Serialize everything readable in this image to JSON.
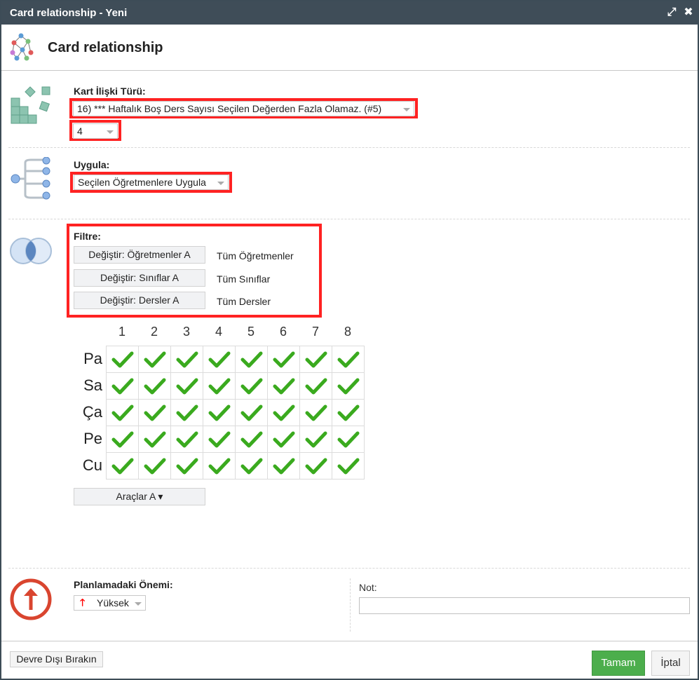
{
  "window": {
    "title": "Card relationship - Yeni",
    "maximize_glyph": "⤢",
    "close_glyph": "✖"
  },
  "header": {
    "title": "Card relationship"
  },
  "card_type": {
    "label": "Kart İlişki Türü:",
    "selected": "16) *** Haftalık Boş Ders Sayısı Seçilen Değerden Fazla Olamaz. (#5)",
    "value_selected": "4"
  },
  "apply": {
    "label": "Uygula:",
    "selected": "Seçilen Öğretmenlere Uygula"
  },
  "filter": {
    "label": "Filtre:",
    "rows": [
      {
        "button": "Değiştir: Öğretmenler A",
        "value": "Tüm Öğretmenler"
      },
      {
        "button": "Değiştir: Sınıflar A",
        "value": "Tüm Sınıflar"
      },
      {
        "button": "Değiştir: Dersler A",
        "value": "Tüm Dersler"
      }
    ]
  },
  "grid": {
    "columns": [
      "1",
      "2",
      "3",
      "4",
      "5",
      "6",
      "7",
      "8"
    ],
    "rows": [
      "Pa",
      "Sa",
      "Ça",
      "Pe",
      "Cu"
    ],
    "check_color": "#3aaa1e",
    "tools_button": "Araçlar A ▾"
  },
  "importance": {
    "label": "Planlamadaki Önemi:",
    "selected": "Yüksek",
    "arrow_glyph": "🡑",
    "icon": "up-arrow-circle-icon",
    "icon_color": "#d9452f"
  },
  "note": {
    "label": "Not:",
    "value": ""
  },
  "footer": {
    "disable_label": "Devre Dışı Bırakın",
    "ok_label": "Tamam",
    "cancel_label": "İptal",
    "ok_color": "#4cae4c"
  }
}
